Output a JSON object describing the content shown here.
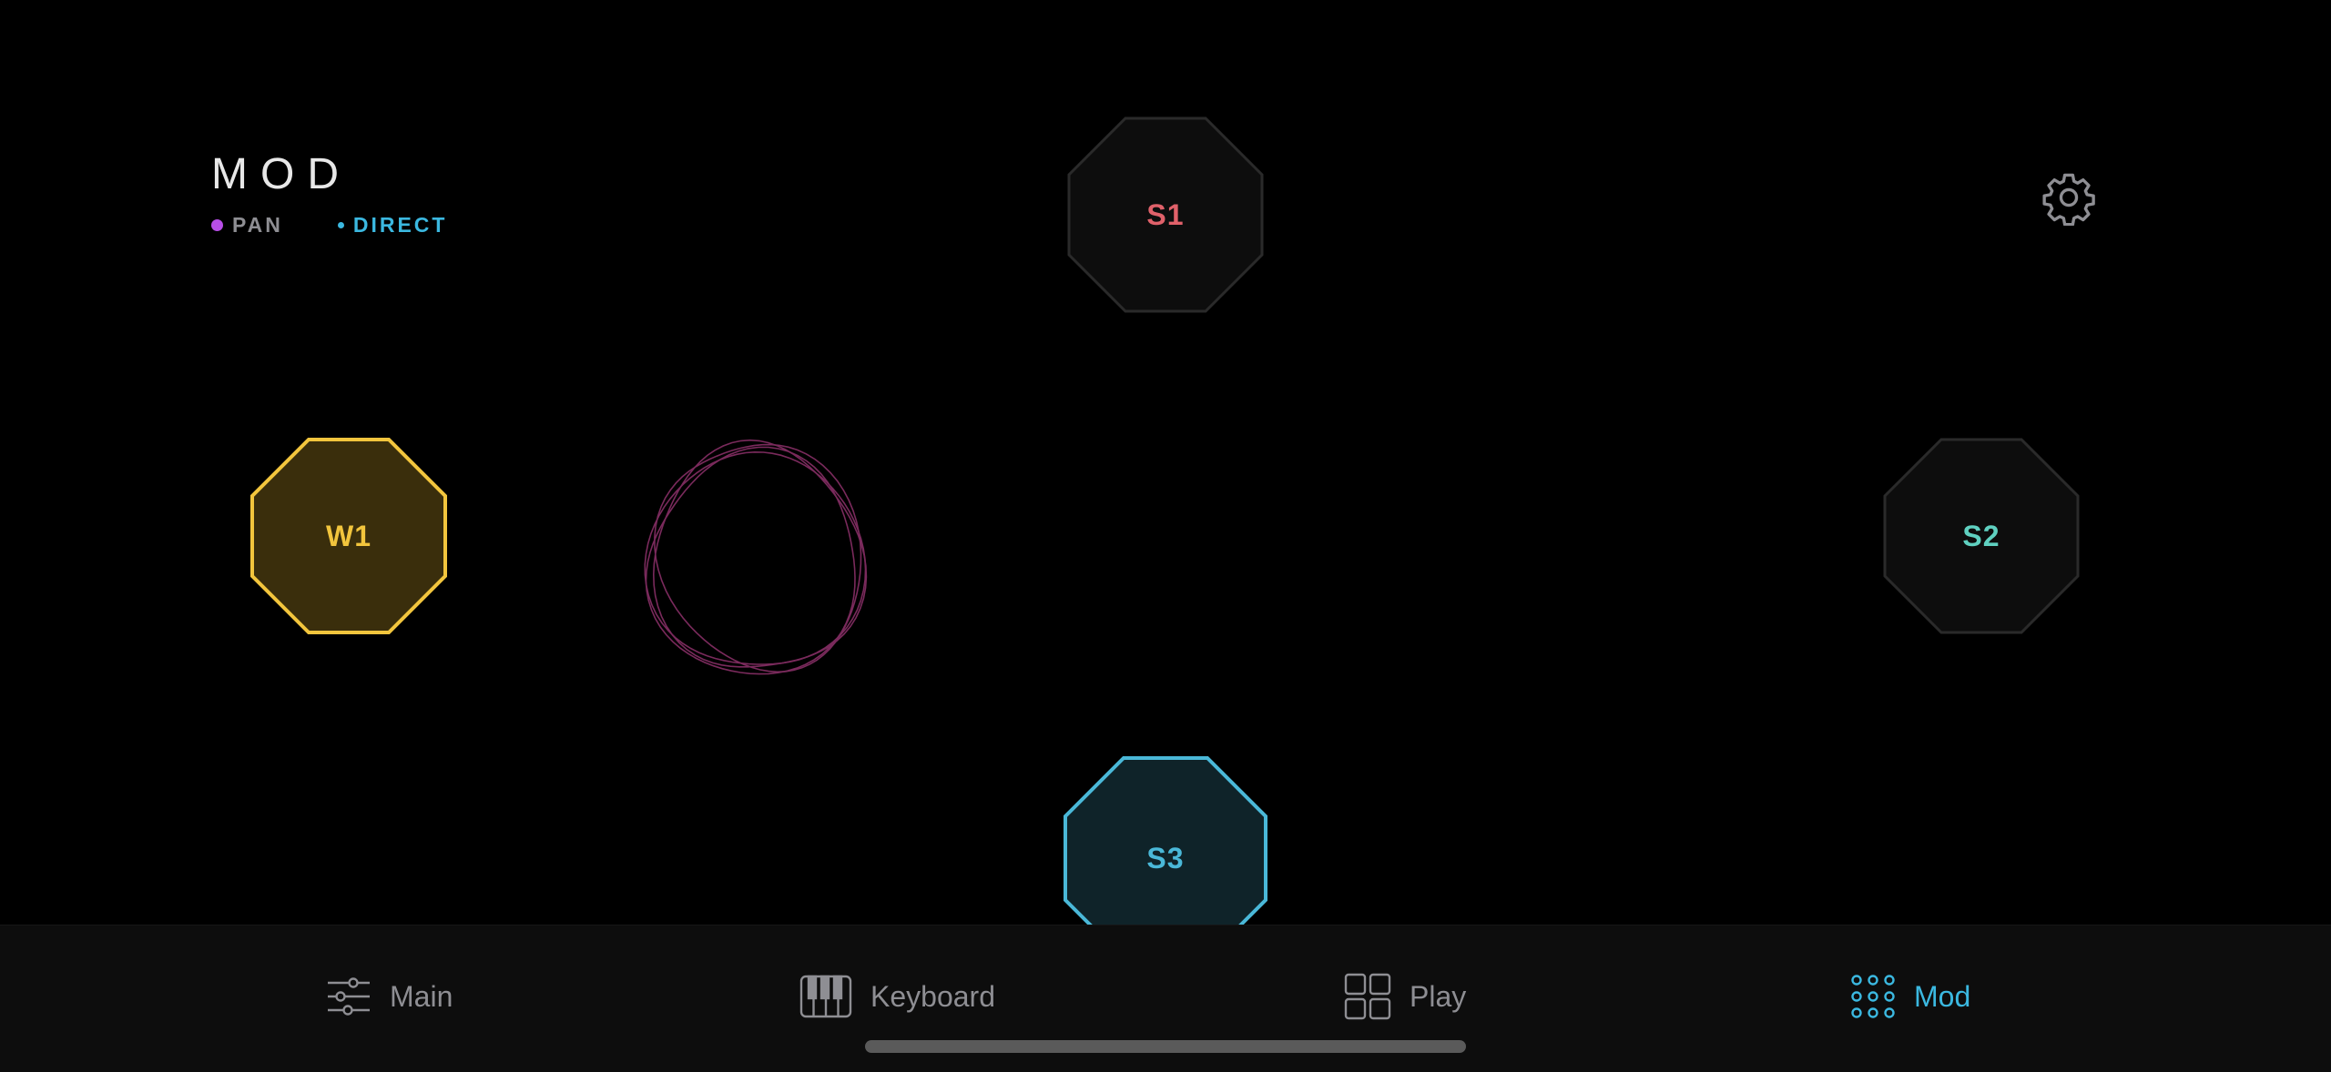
{
  "header": {
    "title": "MOD",
    "legend": [
      {
        "label": "PAN",
        "dot_color": "#b84ee8",
        "text_color": "#8e8e93"
      },
      {
        "label": "DIRECT",
        "dot_color": "#3bb8e0",
        "text_color": "#3bb8e0"
      }
    ]
  },
  "settings": {
    "icon": "gear-icon"
  },
  "nodes": [
    {
      "id": "S1",
      "label": "S1",
      "label_color": "#e0616a",
      "fill": "#0d0d0d",
      "stroke": "#2a2a2a",
      "active": false
    },
    {
      "id": "W1",
      "label": "W1",
      "label_color": "#f2c53d",
      "fill": "#3a2e0c",
      "stroke": "#f2c53d",
      "active": true
    },
    {
      "id": "S2",
      "label": "S2",
      "label_color": "#5fd0c0",
      "fill": "#0d0d0d",
      "stroke": "#2a2a2a",
      "active": false
    },
    {
      "id": "S3",
      "label": "S3",
      "label_color": "#4ab8d8",
      "fill": "#0f2329",
      "stroke": "#4ab8d8",
      "active": true
    }
  ],
  "orbit": {
    "color": "#7a2a5c"
  },
  "tabbar": {
    "active_color": "#3bb8e0",
    "inactive_color": "#8e8e93",
    "tabs": [
      {
        "label": "Main",
        "icon": "sliders-icon",
        "active": false
      },
      {
        "label": "Keyboard",
        "icon": "piano-keys-icon",
        "active": false
      },
      {
        "label": "Play",
        "icon": "grid-squares-icon",
        "active": false
      },
      {
        "label": "Mod",
        "icon": "dot-grid-icon",
        "active": true
      }
    ]
  }
}
